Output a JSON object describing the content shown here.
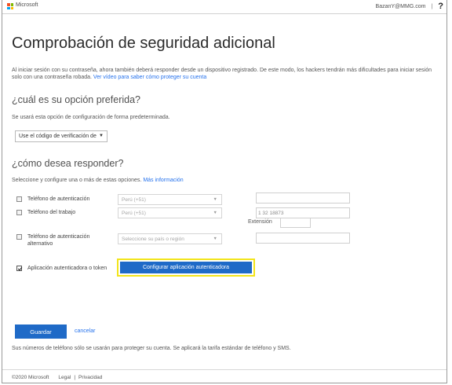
{
  "header": {
    "brand": "Microsoft",
    "user": "BazanY@MMG.com",
    "separator": "|",
    "help": "?"
  },
  "page": {
    "title": "Comprobación de seguridad adicional",
    "intro_text": "Al iniciar sesión con su contraseña, ahora también deberá responder desde un dispositivo registrado. De este modo, los hackers tendrán más dificultades para iniciar sesión solo con una contraseña robada. ",
    "intro_link": "Ver vídeo para saber cómo proteger su cuenta"
  },
  "preferred": {
    "heading": "¿cuál es su opción preferida?",
    "note": "Se usará esta opción de configuración de forma predeterminada.",
    "selected": "Use el código de verificación de",
    "caret": "▼"
  },
  "respond": {
    "heading": "¿cómo desea responder?",
    "note": "Seleccione y configure una o más de estas opciones. ",
    "more_link": "Más información",
    "options": [
      {
        "label": "Teléfono de autenticación",
        "checked": false,
        "country": "Perú (+51)",
        "phone": ""
      },
      {
        "label": "Teléfono del trabajo",
        "checked": false,
        "country": "Perú (+51)",
        "phone": "1 32 18873"
      },
      {
        "label": "Teléfono de autenticación alternativo",
        "checked": false,
        "country": "Seleccione su país o región",
        "phone": ""
      },
      {
        "label": "Aplicación autenticadora o token",
        "checked": true
      }
    ],
    "extension_label": "Extensión",
    "configure_button": "Configurar aplicación autenticadora",
    "dropdown_caret": "▼"
  },
  "actions": {
    "save": "Guardar",
    "cancel": "cancelar",
    "note": "Sus números de teléfono sólo se usarán para proteger su cuenta. Se aplicará la tarifa estándar de teléfono y SMS."
  },
  "footer": {
    "copyright": "©2020 Microsoft",
    "legal": "Legal",
    "divider": "|",
    "privacy": "Privacidad"
  },
  "colors": {
    "accent": "#1f6ac7",
    "link": "#2672ec",
    "highlight": "#f2e41a"
  }
}
